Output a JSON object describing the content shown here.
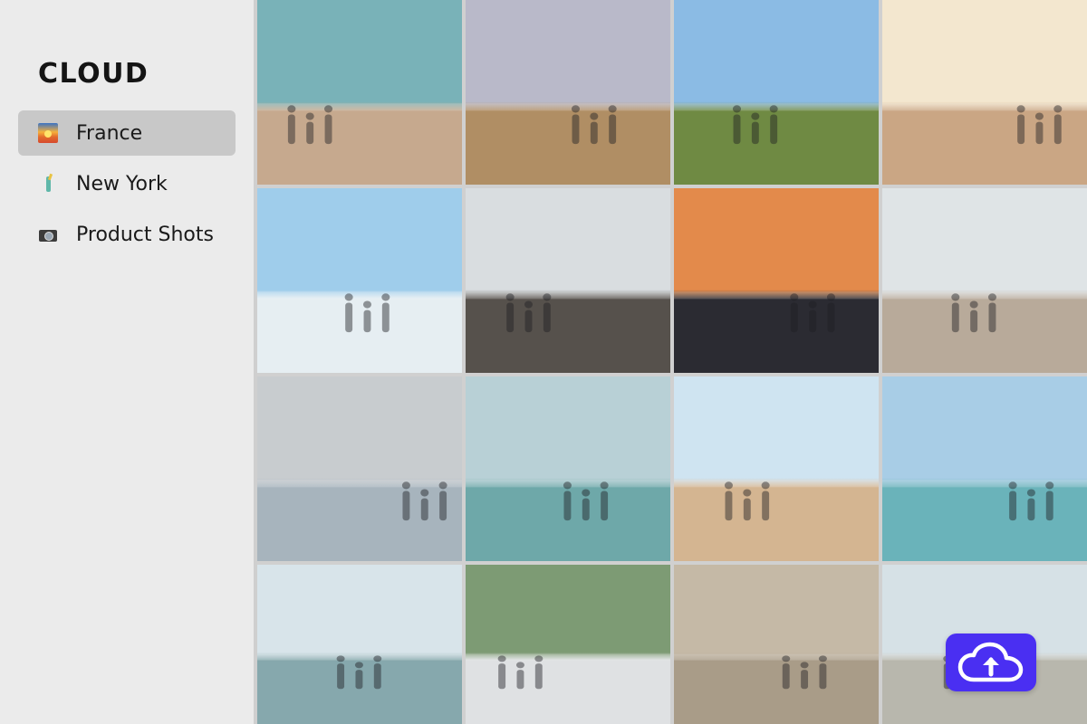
{
  "sidebar": {
    "brand": "CLOUD",
    "items": [
      {
        "label": "France",
        "icon": "sunset-icon",
        "active": true
      },
      {
        "label": "New York",
        "icon": "statue-of-liberty-icon",
        "active": false
      },
      {
        "label": "Product Shots",
        "icon": "camera-icon",
        "active": false
      }
    ]
  },
  "colors": {
    "sidebar_bg": "#ebebeb",
    "active_item_bg": "#c8c8c8",
    "upload_button": "#4a2ff2"
  },
  "gallery": {
    "tiles": [
      {
        "name": "beach-family-sunset",
        "sky": "#79b2b8",
        "ground": "#c6a98e"
      },
      {
        "name": "beach-kids-running",
        "sky": "#b9b9c9",
        "ground": "#b08e64"
      },
      {
        "name": "dunes-path",
        "sky": "#8bbbe4",
        "ground": "#6f8a43"
      },
      {
        "name": "kids-sandcastle",
        "sky": "#f3e7cf",
        "ground": "#caa684"
      },
      {
        "name": "kids-splashing",
        "sky": "#9fcdeb",
        "ground": "#e6eef2"
      },
      {
        "name": "family-rocks",
        "sky": "#d9dde0",
        "ground": "#56514c"
      },
      {
        "name": "group-sunset",
        "sky": "#e38a4b",
        "ground": "#2b2b32"
      },
      {
        "name": "paris-eiffel",
        "sky": "#dfe4e6",
        "ground": "#b8aa9a"
      },
      {
        "name": "girls-holding-hands",
        "sky": "#c8cccf",
        "ground": "#a7b4bd"
      },
      {
        "name": "etretat-cliffs",
        "sky": "#b8d0d6",
        "ground": "#6ea8a9"
      },
      {
        "name": "family-waves",
        "sky": "#cfe4f1",
        "ground": "#d4b591"
      },
      {
        "name": "coast-aerial",
        "sky": "#a8cde6",
        "ground": "#6ab3ba"
      },
      {
        "name": "collioure-town",
        "sky": "#d8e4ea",
        "ground": "#86a8ad"
      },
      {
        "name": "father-son-street",
        "sky": "#7d9b74",
        "ground": "#dfe1e3"
      },
      {
        "name": "crab-sand",
        "sky": "#c5b9a6",
        "ground": "#a99c88"
      },
      {
        "name": "misty-beach",
        "sky": "#d6e1e6",
        "ground": "#b8b7ad"
      }
    ]
  },
  "upload": {
    "icon": "cloud-upload-icon"
  }
}
